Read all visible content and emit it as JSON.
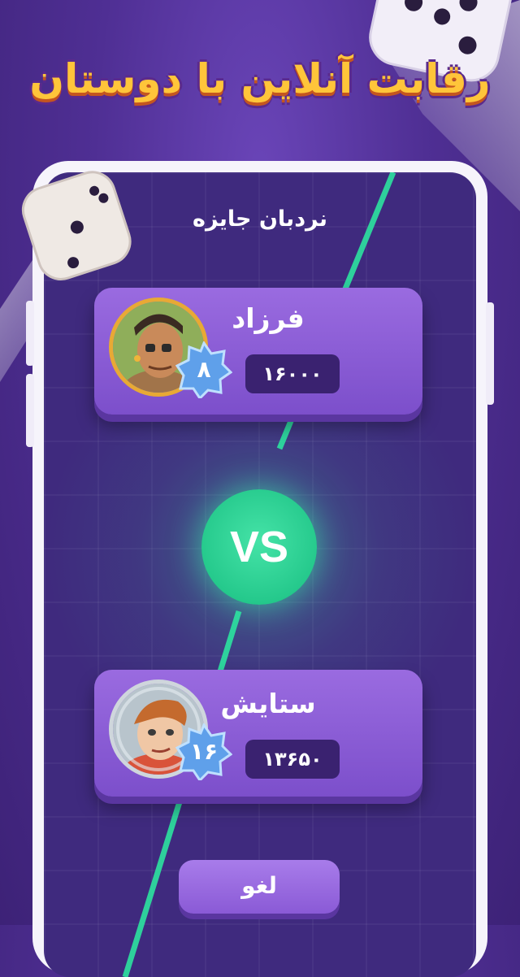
{
  "headline": "رقابت آنلاین با دوستان",
  "screen": {
    "title": "نردبان جایزه",
    "players": [
      {
        "name": "فرزاد",
        "score": "۱۶۰۰۰",
        "level": "۸"
      },
      {
        "name": "ستایش",
        "score": "۱۳۶۵۰",
        "level": "۱۶"
      }
    ],
    "vs_label": "VS",
    "cancel_label": "لغو"
  },
  "colors": {
    "background": "#4f2f94",
    "headline": "#ffc53a",
    "card": "#8a5ad6",
    "accent_green": "#25c98c",
    "badge": "#5fa0ea"
  }
}
